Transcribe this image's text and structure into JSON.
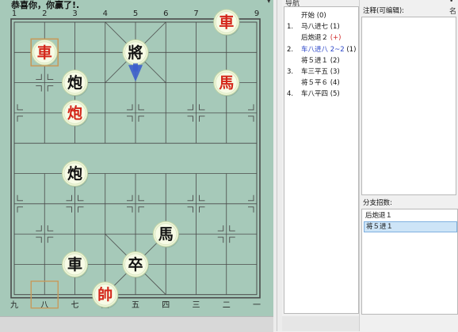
{
  "board": {
    "title": "恭喜你，你赢了!.",
    "menu_icon": "chevron-down-icon",
    "top_coords": [
      "1",
      "2",
      "3",
      "4",
      "5",
      "6",
      "7",
      "8",
      "9"
    ],
    "bottom_coords": [
      "九",
      "八",
      "七",
      "六",
      "五",
      "四",
      "三",
      "二",
      "一"
    ],
    "colors": {
      "board": "#a6c9b9",
      "line": "#4a4a4a",
      "red": "#d4261a",
      "black": "#111111",
      "arrow": "#3d5fcc",
      "marker": "#c79a5b"
    },
    "pieces": [
      {
        "id": "p-red-chariot-top",
        "char": "車",
        "side": "red",
        "col": 7,
        "row": 0
      },
      {
        "id": "p-red-chariot-left",
        "char": "車",
        "side": "red",
        "col": 1,
        "row": 1
      },
      {
        "id": "p-black-general",
        "char": "將",
        "side": "black",
        "col": 4,
        "row": 1
      },
      {
        "id": "p-black-cannon-a",
        "char": "炮",
        "side": "black",
        "col": 2,
        "row": 2
      },
      {
        "id": "p-red-horse",
        "char": "馬",
        "side": "red",
        "col": 7,
        "row": 2
      },
      {
        "id": "p-red-cannon",
        "char": "炮",
        "side": "red",
        "col": 2,
        "row": 3
      },
      {
        "id": "p-black-cannon-b",
        "char": "炮",
        "side": "black",
        "col": 2,
        "row": 5
      },
      {
        "id": "p-black-horse",
        "char": "馬",
        "side": "black",
        "col": 5,
        "row": 7
      },
      {
        "id": "p-black-chariot",
        "char": "車",
        "side": "black",
        "col": 2,
        "row": 8
      },
      {
        "id": "p-black-soldier",
        "char": "卒",
        "side": "black",
        "col": 4,
        "row": 8
      },
      {
        "id": "p-red-king",
        "char": "帥",
        "side": "red",
        "col": 3,
        "row": 9
      }
    ],
    "last_move_from": {
      "col": 1,
      "row": 9
    },
    "last_move_to": {
      "col": 1,
      "row": 1
    },
    "move_arrow": {
      "col": 4,
      "row": 1
    }
  },
  "navigation": {
    "title": "导航",
    "moves": [
      {
        "num": "",
        "text": "开始",
        "count": "(0)",
        "sel": false,
        "red": false
      },
      {
        "num": "1.",
        "text": "马八进七",
        "count": "(1)",
        "sel": false,
        "red": false
      },
      {
        "num": "",
        "text": "后炮退２",
        "count": "(+)",
        "sel": false,
        "red": true
      },
      {
        "num": "2.",
        "text": "车八进八 2~2",
        "count": "(1)",
        "sel": true,
        "red": false
      },
      {
        "num": "",
        "text": "将５进１",
        "count": "(2)",
        "sel": false,
        "red": false
      },
      {
        "num": "3.",
        "text": "车三平五",
        "count": "(3)",
        "sel": false,
        "red": false
      },
      {
        "num": "",
        "text": "将５平６",
        "count": "(4)",
        "sel": false,
        "red": false
      },
      {
        "num": "4.",
        "text": "车八平四",
        "count": "(5)",
        "sel": false,
        "red": false
      }
    ]
  },
  "comment": {
    "label": "注释(可编辑):",
    "menu_label": "• 名",
    "value": ""
  },
  "branches": {
    "label": "分支招数:",
    "items": [
      {
        "text": "后炮退１",
        "sel": false
      },
      {
        "text": "将５进１",
        "sel": true
      }
    ]
  }
}
